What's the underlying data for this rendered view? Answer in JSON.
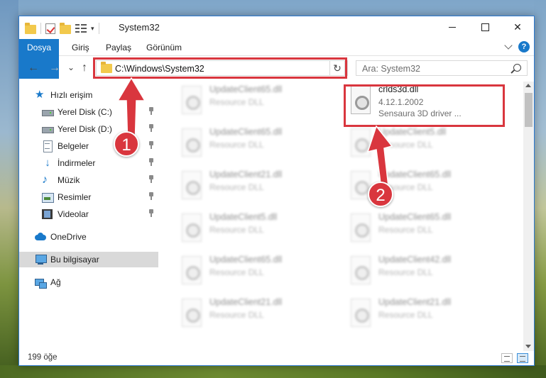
{
  "window": {
    "title": "System32",
    "close_glyph": "✕"
  },
  "ribbon": {
    "tabs": [
      "Dosya",
      "Giriş",
      "Paylaş",
      "Görünüm"
    ],
    "help_glyph": "?"
  },
  "address": {
    "path": "C:\\Windows\\System32",
    "search_placeholder": "Ara: System32"
  },
  "nav": {
    "back": "←",
    "forward": "→",
    "recent": "⌄",
    "up": "↑",
    "dropdown": "⌄",
    "refresh": "↻"
  },
  "sidebar": {
    "quick_access": "Hızlı erişim",
    "items": [
      {
        "label": "Yerel Disk (C:)",
        "icon": "disk-icon",
        "pinned": true
      },
      {
        "label": "Yerel Disk (D:)",
        "icon": "disk-icon",
        "pinned": true
      },
      {
        "label": "Belgeler",
        "icon": "document-icon",
        "pinned": true
      },
      {
        "label": "İndirmeler",
        "icon": "download-icon",
        "pinned": true
      },
      {
        "label": "Müzik",
        "icon": "music-icon",
        "pinned": true
      },
      {
        "label": "Resimler",
        "icon": "pictures-icon",
        "pinned": true
      },
      {
        "label": "Videolar",
        "icon": "videos-icon",
        "pinned": true
      }
    ],
    "onedrive": "OneDrive",
    "this_pc": "Bu bilgisayar",
    "network": "Ağ"
  },
  "files": {
    "left": [
      {
        "name": "UpdateClient65.dll",
        "desc": "Resource DLL"
      },
      {
        "name": "UpdateClient65.dll",
        "desc": "Resource DLL"
      },
      {
        "name": "UpdateClient21.dll",
        "desc": "Resource DLL"
      },
      {
        "name": "UpdateClient5.dll",
        "desc": "Resource DLL"
      },
      {
        "name": "UpdateClient65.dll",
        "desc": "Resource DLL"
      },
      {
        "name": "UpdateClient21.dll",
        "desc": "Resource DLL"
      }
    ],
    "featured": {
      "name": "crlds3d.dll",
      "version": "4.12.1.2002",
      "desc": "Sensaura 3D driver ..."
    },
    "right": [
      {
        "name": "UpdateClient5.dll",
        "desc": "Resource DLL"
      },
      {
        "name": "UpdateClient65.dll",
        "desc": "Resource DLL"
      },
      {
        "name": "UpdateClient65.dll",
        "desc": "Resource DLL"
      },
      {
        "name": "UpdateClient42.dll",
        "desc": "Resource DLL"
      },
      {
        "name": "UpdateClient21.dll",
        "desc": "Resource DLL"
      }
    ]
  },
  "status": {
    "item_count": "199 öğe"
  },
  "annotations": {
    "badge1": "1",
    "badge2": "2",
    "color": "#d9363e"
  }
}
